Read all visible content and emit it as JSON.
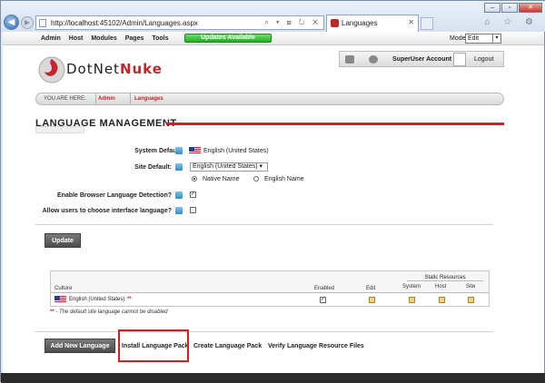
{
  "browser": {
    "url_prefix": "http://",
    "url_host": "localhost",
    "url_rest": ":45102/Admin/Languages.aspx",
    "address_controls": "⌕ ▾ ⊠ ↻ ✕",
    "tab_title": "Languages",
    "tab_close": "✕",
    "back": "◀",
    "forward": "▶",
    "win_min": "–",
    "win_max": "▫",
    "win_close": "✕",
    "tool_icons": "⌂ ☆ ⚙",
    "icons": [
      "back-icon",
      "forward-icon",
      "page-icon",
      "search-icon",
      "refresh-icon",
      "home-icon",
      "star-icon",
      "gear-icon"
    ]
  },
  "control_bar": {
    "menu": [
      "Admin",
      "Host",
      "Modules",
      "Pages",
      "Tools"
    ],
    "updates_label": "Updates Available",
    "mode_label": "Mode",
    "mode_value": "Edit",
    "mode_arrow": "▾"
  },
  "header": {
    "logo_text_1": "DotNet",
    "logo_text_2": "Nuke",
    "account_label": "SuperUser Account",
    "logout_label": "Logout"
  },
  "breadcrumb": {
    "you_are_here": "YOU ARE HERE:",
    "items": [
      "Admin",
      "Languages"
    ]
  },
  "page_title": "LANGUAGE MANAGEMENT",
  "form": {
    "system_default_label": "System Default:",
    "system_default_value": "English (United States)",
    "site_default_label": "Site Default:",
    "site_default_value": "English (United States)",
    "site_default_arrow": "▾",
    "radio_native": "Native Name",
    "radio_english": "English Name",
    "browser_detection_label": "Enable Browser Language Detection?",
    "browser_detection_check": "✓",
    "allow_users_label": "Allow users to choose interface language?",
    "update_button": "Update"
  },
  "grid": {
    "columns": [
      "Culture",
      "Enabled",
      "Edit",
      "System",
      "Host",
      "Site"
    ],
    "static_resources": "Static Resources",
    "rows": [
      {
        "culture": "English (United States)",
        "marker": "**",
        "enabled_check": "✓"
      }
    ]
  },
  "note": {
    "marker": "**",
    "text": " - The default site language cannot be disabled"
  },
  "actions": {
    "add_new_language": "Add New Language",
    "install_language_pack": "Install Language Pack",
    "create_language_pack": "Create Language Pack",
    "verify_resource_files": "Verify Language Resource Files"
  },
  "colors": {
    "brand_red": "#c4242a",
    "highlight_red": "#e01b1b",
    "updates_green": "#27a826"
  }
}
